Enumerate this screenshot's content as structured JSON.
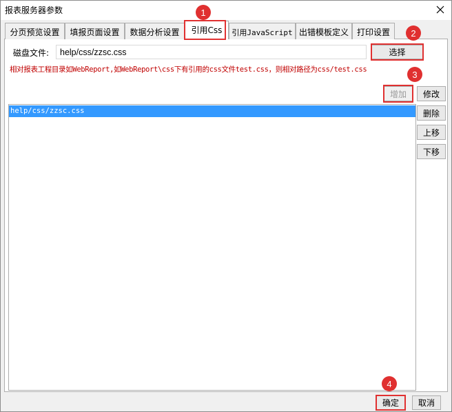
{
  "window": {
    "title": "报表服务器参数"
  },
  "tabs": [
    {
      "label": "分页预览设置"
    },
    {
      "label": "填报页面设置"
    },
    {
      "label": "数据分析设置"
    },
    {
      "label": "引用Css"
    },
    {
      "label": "引用JavaScript"
    },
    {
      "label": "出错模板定义"
    },
    {
      "label": "打印设置"
    }
  ],
  "css_tab": {
    "disk_file_label": "磁盘文件:",
    "path_value": "help/css/zzsc.css",
    "choose_button": "选择",
    "hint": "相对报表工程目录如WebReport,如WebReport\\css下有引用的css文件test.css，则相对路径为css/test.css",
    "add_button": "增加",
    "modify_button": "修改",
    "delete_button": "删除",
    "move_up_button": "上移",
    "move_down_button": "下移",
    "list_items": [
      "help/css/zzsc.css"
    ]
  },
  "footer": {
    "ok_button": "确定",
    "cancel_button": "取消"
  },
  "markers": [
    "1",
    "2",
    "3",
    "4"
  ],
  "colors": {
    "marker": "#e03030",
    "selection": "#3399ff",
    "hint_text": "#c00000"
  }
}
